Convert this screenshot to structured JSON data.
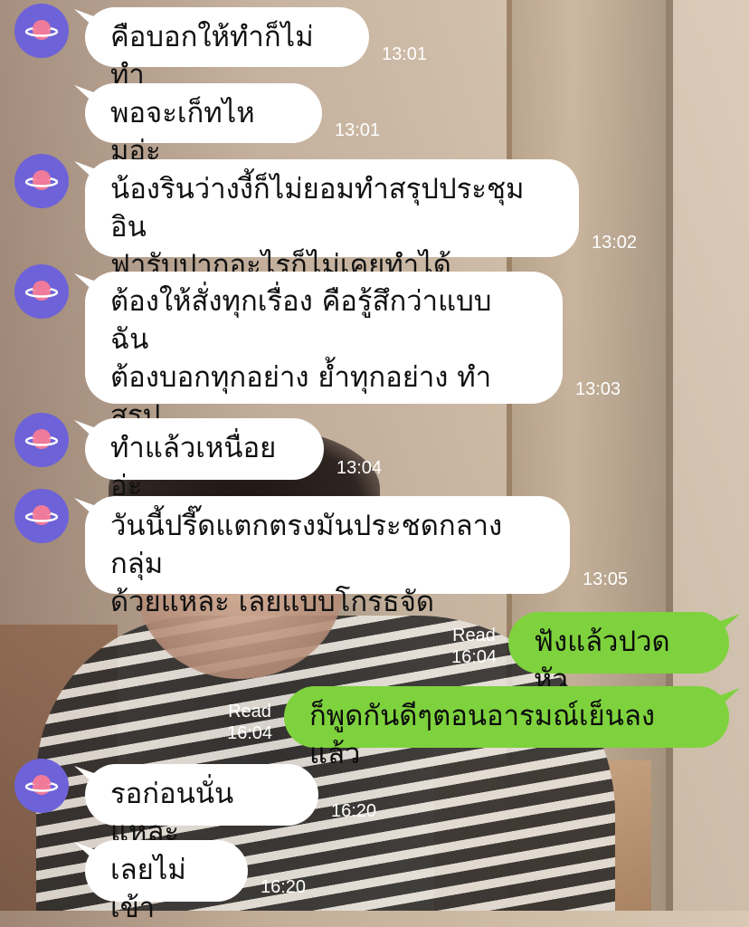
{
  "avatar": {
    "icon": "planet-icon",
    "color": "#6e62d8",
    "planet_color": "#f07a9a"
  },
  "messages": [
    {
      "dir": "in",
      "text": "คือบอกให้ทำก็ไม่ทำ",
      "time": "13:01",
      "avatar": true
    },
    {
      "dir": "in",
      "text": "พอจะเก็ทไหมอ่ะ",
      "time": "13:01",
      "avatar": false
    },
    {
      "dir": "in",
      "text": "น้องรินว่างงี้ก็ไม่ยอมทำสรุปประชุม อิน\nฟารับปากอะไรก็ไม่เคยทำได้",
      "time": "13:02",
      "avatar": true
    },
    {
      "dir": "in",
      "text": "ต้องให้สั่งทุกเรื่อง คือรู้สึกว่าแบบ ฉัน\nต้องบอกทุกอย่าง ย้ำทุกอย่าง ทำสรุป\nประชุมอีก",
      "time": "13:03",
      "avatar": true
    },
    {
      "dir": "in",
      "text": "ทำแล้วเหนื่อยอ่ะ",
      "time": "13:04",
      "avatar": true
    },
    {
      "dir": "in",
      "text": "วันนี้ปรี๊ดแตกตรงมันประชดกลางกลุ่ม\nด้วยแหละ เลยแบบโกรธจัด",
      "time": "13:05",
      "avatar": true
    },
    {
      "dir": "out",
      "text": "ฟังแล้วปวดหัว",
      "read": "Read",
      "time": "16:04"
    },
    {
      "dir": "out",
      "text": "ก็พูดกันดีๆตอนอารมณ์เย็นลงแล้ว",
      "read": "Read",
      "time": "16:04"
    },
    {
      "dir": "in",
      "text": "รอก่อนนั่นแหละ",
      "time": "16:20",
      "avatar": true
    },
    {
      "dir": "in",
      "text": "เลยไม่เข้า",
      "time": "16:20",
      "avatar": false
    }
  ],
  "colors": {
    "incoming_bubble": "#ffffff",
    "outgoing_bubble": "#7ed23d",
    "timestamp": "#ffffff"
  }
}
